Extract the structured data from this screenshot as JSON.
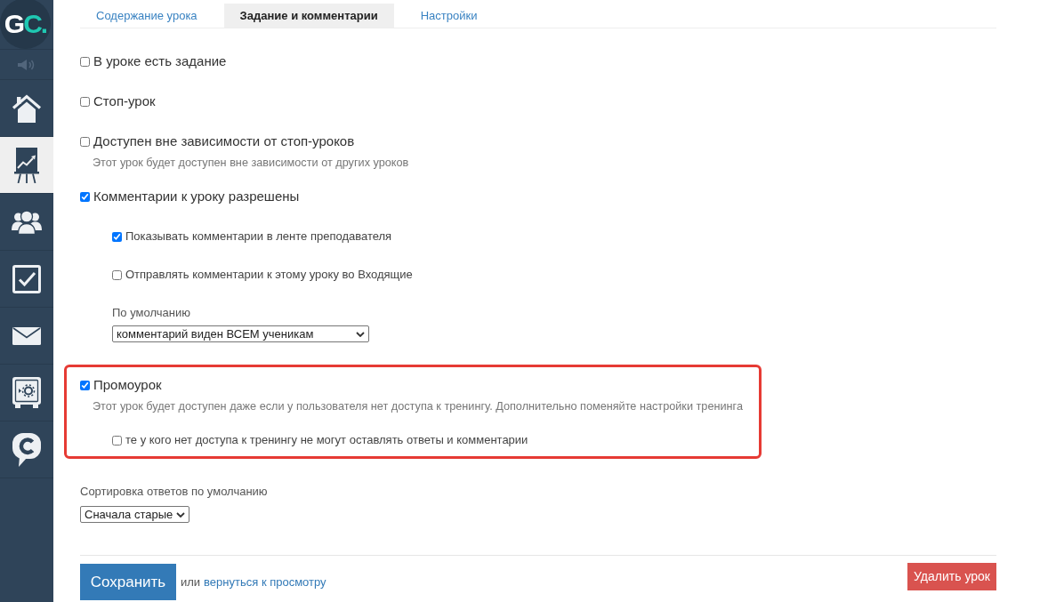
{
  "sidebar": {
    "logo": {
      "text": "G",
      "accent": "C."
    },
    "items": [
      {
        "selected": false
      },
      {
        "selected": true
      },
      {
        "selected": false
      },
      {
        "selected": false
      },
      {
        "selected": false
      },
      {
        "selected": false
      },
      {
        "selected": false
      }
    ]
  },
  "tabs": [
    {
      "label": "Содержание урока",
      "selected": false
    },
    {
      "label": "Задание и комментарии",
      "selected": true
    },
    {
      "label": "Настройки",
      "selected": false
    }
  ],
  "options": [
    {
      "kind": "checkbox",
      "label": "В уроке есть задание",
      "checked": false,
      "highlighted": false
    },
    {
      "kind": "checkbox",
      "label": "Стоп-урок",
      "checked": false,
      "highlighted": false
    },
    {
      "kind": "checkbox",
      "label": "Доступен вне зависимости от стоп-уроков",
      "checked": false,
      "highlighted": false,
      "hint": "Этот урок будет доступен вне зависимости от других уроков"
    },
    {
      "kind": "checkbox",
      "label": "Комментарии к уроку разрешены",
      "checked": true,
      "highlighted": false,
      "children": [
        {
          "kind": "checkbox",
          "label": "Показывать комментарии в ленте преподавателя",
          "checked": true
        },
        {
          "kind": "checkbox",
          "label": "Отправлять комментарии к этому уроку во Входящие",
          "checked": false
        },
        {
          "kind": "select",
          "label": "По умолчанию",
          "value": "комментарий виден ВСЕМ ученикам"
        }
      ]
    },
    {
      "kind": "checkbox",
      "label": "Промоурок",
      "checked": true,
      "highlighted": true,
      "hint": "Этот урок будет доступен даже если у пользователя нет доступа к тренингу. Дополнительно поменяйте настройки тренинга",
      "children": [
        {
          "kind": "checkbox",
          "label": "те у кого нет доступа к тренингу не могут оставлять ответы и комментарии",
          "checked": false
        }
      ]
    }
  ],
  "sort": {
    "label": "Сортировка ответов по умолчанию",
    "value": "Сначала старые"
  },
  "actions": {
    "save": "Сохранить",
    "separator": "или",
    "back_link": "вернуться к просмотру",
    "delete": "Удалить урок"
  }
}
